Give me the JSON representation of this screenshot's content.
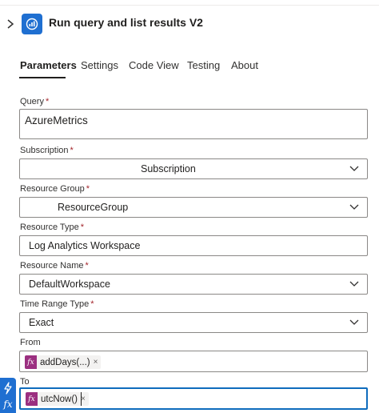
{
  "header": {
    "title": "Run query and list results V2"
  },
  "tabs": [
    {
      "label": "Parameters",
      "active": true
    },
    {
      "label": "Settings"
    },
    {
      "label": "Code View"
    },
    {
      "label": "Testing"
    },
    {
      "label": "About"
    }
  ],
  "fields": {
    "query": {
      "label": "Query",
      "required_mark": "*",
      "value": "AzureMetrics"
    },
    "subscription": {
      "label": "Subscription",
      "required_mark": "*",
      "value": "Subscription"
    },
    "resource_group": {
      "label": "Resource Group",
      "required_mark": "*",
      "value": "ResourceGroup"
    },
    "resource_type": {
      "label": "Resource Type",
      "required_mark": "*",
      "value": "Log Analytics Workspace"
    },
    "resource_name": {
      "label": "Resource Name",
      "required_mark": "*",
      "value": "DefaultWorkspace"
    },
    "time_range_type": {
      "label": "Time Range Type",
      "required_mark": "*",
      "value": "Exact"
    },
    "from": {
      "label": "From",
      "token": "addDays(...)",
      "token_icon": "fx",
      "remove": "×"
    },
    "to": {
      "label": "To",
      "token": "utcNow()",
      "token_icon": "fx",
      "remove": "×"
    }
  },
  "side_panel": {
    "icons": [
      "lightning-icon",
      "fx-icon"
    ],
    "fx_glyph": "fx"
  },
  "colors": {
    "accent": "#1f6fd1",
    "token": "#9b2f80",
    "required": "#a4262c",
    "focus": "#0f6cbd"
  }
}
